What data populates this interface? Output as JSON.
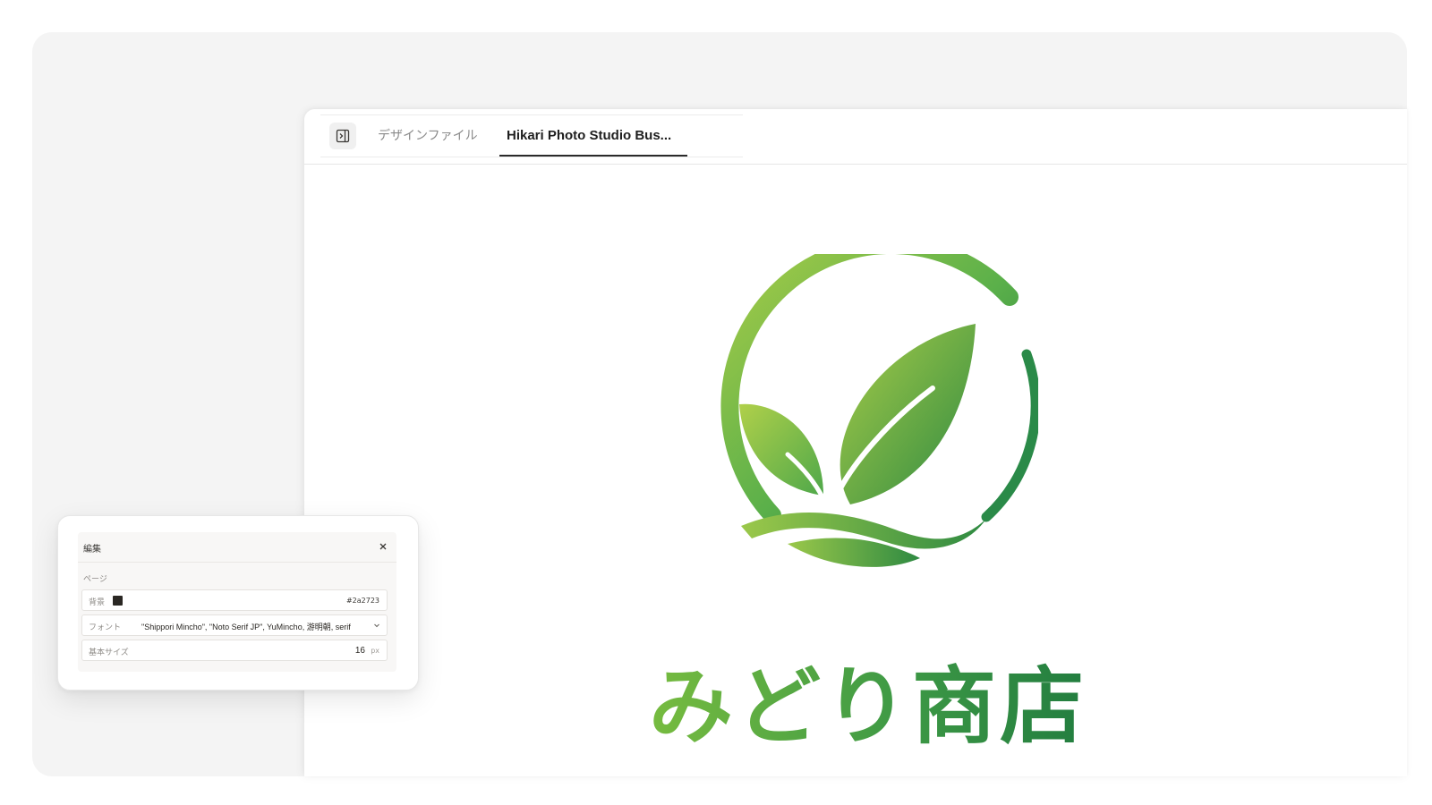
{
  "tabs": {
    "items": [
      {
        "label": "デザインファイル"
      },
      {
        "label": "Hikari Photo Studio Bus..."
      }
    ],
    "active_index": 1
  },
  "icons": {
    "sidebar_toggle": "sidebar-toggle-icon",
    "close": "close-icon",
    "dropdown": "chevron-down-icon",
    "logo": "leaf-circle-logo"
  },
  "canvas": {
    "brand_name": "みどり商店",
    "colors": {
      "light_green": "#9bc84a",
      "mid_green": "#4fa84a",
      "dark_green": "#1f7a3f"
    }
  },
  "editor": {
    "title": "編集",
    "section_label": "ページ",
    "background": {
      "label": "背景",
      "value": "#2a2723"
    },
    "font": {
      "label": "フォント",
      "value": "\"Shippori Mincho\", \"Noto Serif JP\", YuMincho, 游明朝, serif"
    },
    "base_size": {
      "label": "基本サイズ",
      "value": "16",
      "unit": "px"
    }
  },
  "theme": {
    "backdrop": "#f4f4f4",
    "tab_active_underline": "#2a2a2a"
  }
}
